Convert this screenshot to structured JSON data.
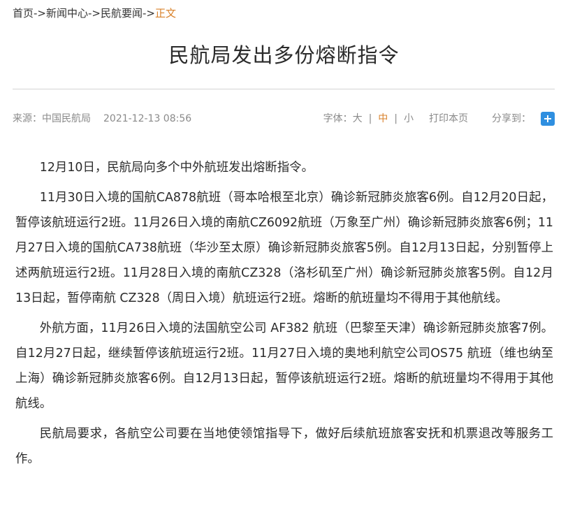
{
  "breadcrumb": {
    "items": [
      {
        "label": "首页"
      },
      {
        "label": "新闻中心"
      },
      {
        "label": "民航要闻"
      }
    ],
    "separator": "->",
    "current": "正文"
  },
  "article": {
    "title": "民航局发出多份熔断指令",
    "source_label": "来源：中国民航局",
    "date": "2021-12-13 08:56",
    "paragraphs": [
      "12月10日，民航局向多个中外航班发出熔断指令。",
      "11月30日入境的国航CA878航班（哥本哈根至北京）确诊新冠肺炎旅客6例。自12月20日起，暂停该航班运行2班。11月26日入境的南航CZ6092航班（万象至广州）确诊新冠肺炎旅客6例；11月27日入境的国航CA738航班（华沙至太原）确诊新冠肺炎旅客5例。自12月13日起，分别暂停上述两航班运行2班。11月28日入境的南航CZ328（洛杉矶至广州）确诊新冠肺炎旅客5例。自12月13日起，暂停南航 CZ328（周日入境）航班运行2班。熔断的航班量均不得用于其他航线。",
      "外航方面，11月26日入境的法国航空公司 AF382 航班（巴黎至天津）确诊新冠肺炎旅客7例。自12月27日起，继续暂停该航班运行2班。11月27日入境的奥地利航空公司OS75 航班（维也纳至上海）确诊新冠肺炎旅客6例。自12月13日起，暂停该航班运行2班。熔断的航班量均不得用于其他航线。",
      "民航局要求，各航空公司要在当地使领馆指导下，做好后续航班旅客安抚和机票退改等服务工作。"
    ]
  },
  "toolbar": {
    "font_size_label": "字体：",
    "font_large": "大",
    "font_medium": "中",
    "font_small": "小",
    "font_sep": "|",
    "print_label": "打印本页",
    "share_label": "分享到：",
    "share_icon": "plus-icon"
  },
  "colors": {
    "accent": "#d9822b",
    "share_button": "#2f8fe0",
    "meta_text": "#8a8a8a"
  }
}
